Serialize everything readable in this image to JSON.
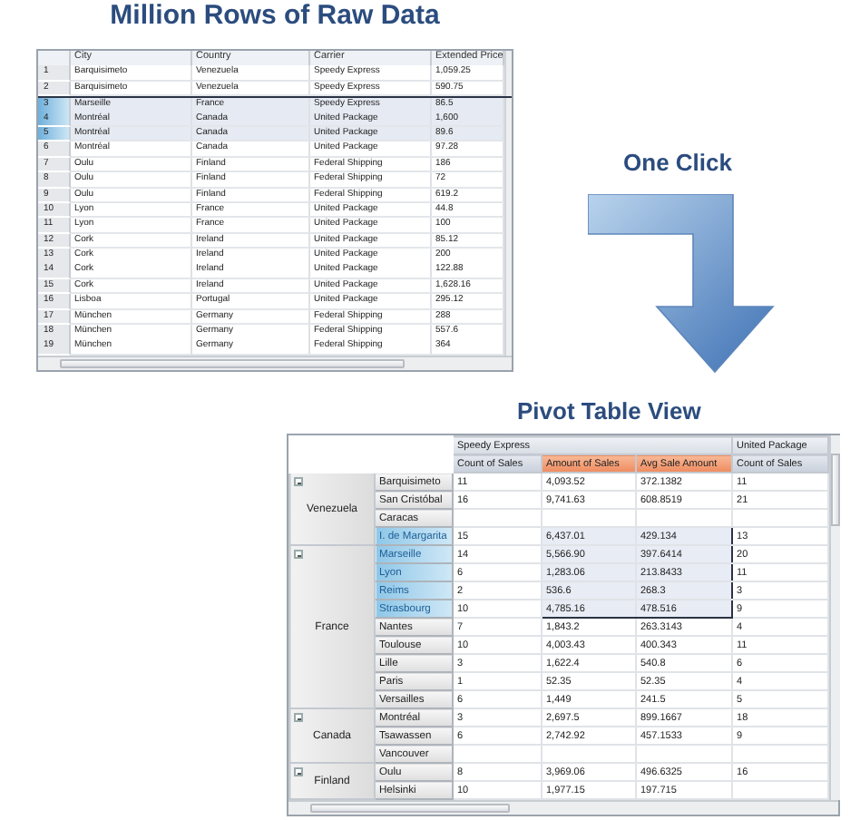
{
  "raw": {
    "title": "Million Rows of Raw Data",
    "columns": [
      "City",
      "Country",
      "Carrier",
      "Extended Price"
    ],
    "rows": [
      {
        "number": "1",
        "cells": [
          "Barquisimeto",
          "Venezuela",
          "Speedy Express",
          "1,059.25"
        ],
        "selected": false
      },
      {
        "number": "2",
        "cells": [
          "Barquisimeto",
          "Venezuela",
          "Speedy Express",
          "590.75"
        ],
        "selected": false
      },
      {
        "number": "3",
        "cells": [
          "Marseille",
          "France",
          "Speedy Express",
          "86.5"
        ],
        "selected": true
      },
      {
        "number": "4",
        "cells": [
          "Montréal",
          "Canada",
          "United Package",
          "1,600"
        ],
        "selected": true
      },
      {
        "number": "5",
        "cells": [
          "Montréal",
          "Canada",
          "United Package",
          "89.6"
        ],
        "selected": true
      },
      {
        "number": "6",
        "cells": [
          "Montréal",
          "Canada",
          "United Package",
          "97.28"
        ],
        "selected": false
      },
      {
        "number": "7",
        "cells": [
          "Oulu",
          "Finland",
          "Federal Shipping",
          "186"
        ],
        "selected": false
      },
      {
        "number": "8",
        "cells": [
          "Oulu",
          "Finland",
          "Federal Shipping",
          "72"
        ],
        "selected": false
      },
      {
        "number": "9",
        "cells": [
          "Oulu",
          "Finland",
          "Federal Shipping",
          "619.2"
        ],
        "selected": false
      },
      {
        "number": "10",
        "cells": [
          "Lyon",
          "France",
          "United Package",
          "44.8"
        ],
        "selected": false
      },
      {
        "number": "11",
        "cells": [
          "Lyon",
          "France",
          "United Package",
          "100"
        ],
        "selected": false
      },
      {
        "number": "12",
        "cells": [
          "Cork",
          "Ireland",
          "United Package",
          "85.12"
        ],
        "selected": false
      },
      {
        "number": "13",
        "cells": [
          "Cork",
          "Ireland",
          "United Package",
          "200"
        ],
        "selected": false
      },
      {
        "number": "14",
        "cells": [
          "Cork",
          "Ireland",
          "United Package",
          "122.88"
        ],
        "selected": false
      },
      {
        "number": "15",
        "cells": [
          "Cork",
          "Ireland",
          "United Package",
          "1,628.16"
        ],
        "selected": false
      },
      {
        "number": "16",
        "cells": [
          "Lisboa",
          "Portugal",
          "United Package",
          "295.12"
        ],
        "selected": false
      },
      {
        "number": "17",
        "cells": [
          "München",
          "Germany",
          "Federal Shipping",
          "288"
        ],
        "selected": false
      },
      {
        "number": "18",
        "cells": [
          "München",
          "Germany",
          "Federal Shipping",
          "557.6"
        ],
        "selected": false
      },
      {
        "number": "19",
        "cells": [
          "München",
          "Germany",
          "Federal Shipping",
          "364"
        ],
        "selected": false
      }
    ]
  },
  "one_click": {
    "label": "One Click"
  },
  "pivot": {
    "title": "Pivot Table View",
    "carriers": [
      "Speedy Express",
      "United Package"
    ],
    "measures": [
      {
        "label": "Count of Sales",
        "selected": false
      },
      {
        "label": "Amount of Sales",
        "selected": true
      },
      {
        "label": "Avg Sale Amount",
        "selected": true
      },
      {
        "label": "Count of Sales",
        "selected": false
      }
    ],
    "groups": [
      {
        "country": "Venezuela",
        "expanded": true,
        "cities": [
          {
            "name": "Barquisimeto",
            "selected": false,
            "cells": [
              "11",
              "4,093.52",
              "372.1382",
              "11"
            ]
          },
          {
            "name": "San Cristóbal",
            "selected": false,
            "cells": [
              "16",
              "9,741.63",
              "608.8519",
              "21"
            ]
          },
          {
            "name": "Caracas",
            "selected": false
          },
          {
            "name": "I. de Margarita",
            "selected": true,
            "cells": [
              "15",
              "6,437.01",
              "429.134",
              "13"
            ]
          }
        ]
      },
      {
        "country": "France",
        "expanded": true,
        "cities": [
          {
            "name": "Marseille",
            "selected": true,
            "cells": [
              "14",
              "5,566.90",
              "397.6414",
              "20"
            ]
          },
          {
            "name": "Lyon",
            "selected": true,
            "cells": [
              "6",
              "1,283.06",
              "213.8433",
              "11"
            ]
          },
          {
            "name": "Reims",
            "selected": true,
            "cells": [
              "2",
              "536.6",
              "268.3",
              "3"
            ]
          },
          {
            "name": "Strasbourg",
            "selected": true,
            "cells": [
              "10",
              "4,785.16",
              "478.516",
              "9"
            ]
          },
          {
            "name": "Nantes",
            "selected": false,
            "cells": [
              "7",
              "1,843.2",
              "263.3143",
              "4"
            ]
          },
          {
            "name": "Toulouse",
            "selected": false,
            "cells": [
              "10",
              "4,003.43",
              "400.343",
              "11"
            ]
          },
          {
            "name": "Lille",
            "selected": false,
            "cells": [
              "3",
              "1,622.4",
              "540.8",
              "6"
            ]
          },
          {
            "name": "Paris",
            "selected": false,
            "cells": [
              "1",
              "52.35",
              "52.35",
              "4"
            ]
          },
          {
            "name": "Versailles",
            "selected": false,
            "cells": [
              "6",
              "1,449",
              "241.5",
              "5"
            ]
          }
        ]
      },
      {
        "country": "Canada",
        "expanded": true,
        "cities": [
          {
            "name": "Montréal",
            "selected": false,
            "cells": [
              "3",
              "2,697.5",
              "899.1667",
              "18"
            ]
          },
          {
            "name": "Tsawassen",
            "selected": false,
            "cells": [
              "6",
              "2,742.92",
              "457.1533",
              "9"
            ]
          },
          {
            "name": "Vancouver",
            "selected": false
          }
        ]
      },
      {
        "country": "Finland",
        "expanded": true,
        "cities": [
          {
            "name": "Oulu",
            "selected": false,
            "cells": [
              "8",
              "3,969.06",
              "496.6325",
              "16"
            ]
          },
          {
            "name": "Helsinki",
            "selected": false,
            "cells": [
              "10",
              "1,977.15",
              "197.715"
            ]
          }
        ]
      }
    ]
  }
}
